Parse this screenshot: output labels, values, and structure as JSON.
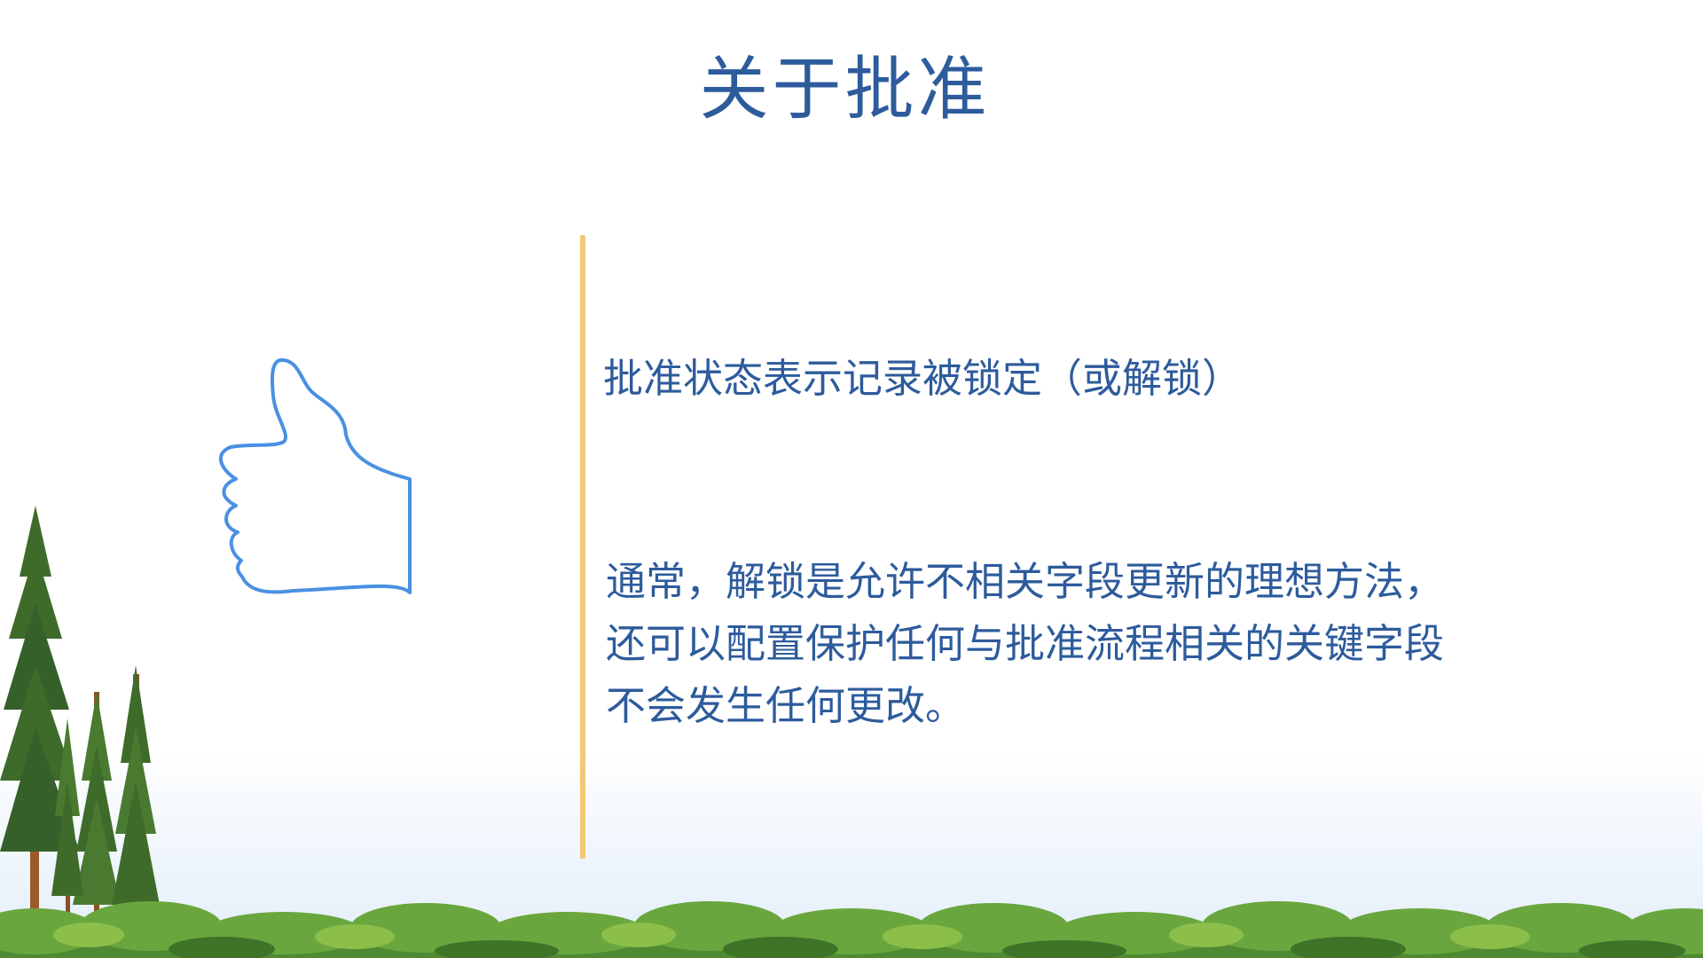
{
  "slide": {
    "title": "关于批准",
    "statement": "批准状态表示记录被锁定（或解锁）",
    "paragraph_lines": [
      "通常，解锁是允许不相关字段更新的理想方法，",
      "还可以配置保护任何与批准流程相关的关键字段",
      "不会发生任何更改。"
    ]
  },
  "icons": {
    "thumb": "thumbs-up-icon",
    "trees": "pine-trees-illustration",
    "bushes": "shrub-border-illustration"
  },
  "colors": {
    "text": "#2d5b9c",
    "divider": "#f2c878",
    "icon_stroke": "#4a90e2",
    "tree_green": "#3f6b2a",
    "trunk": "#9a5a2a",
    "bush_green": "#5f9a3a"
  }
}
